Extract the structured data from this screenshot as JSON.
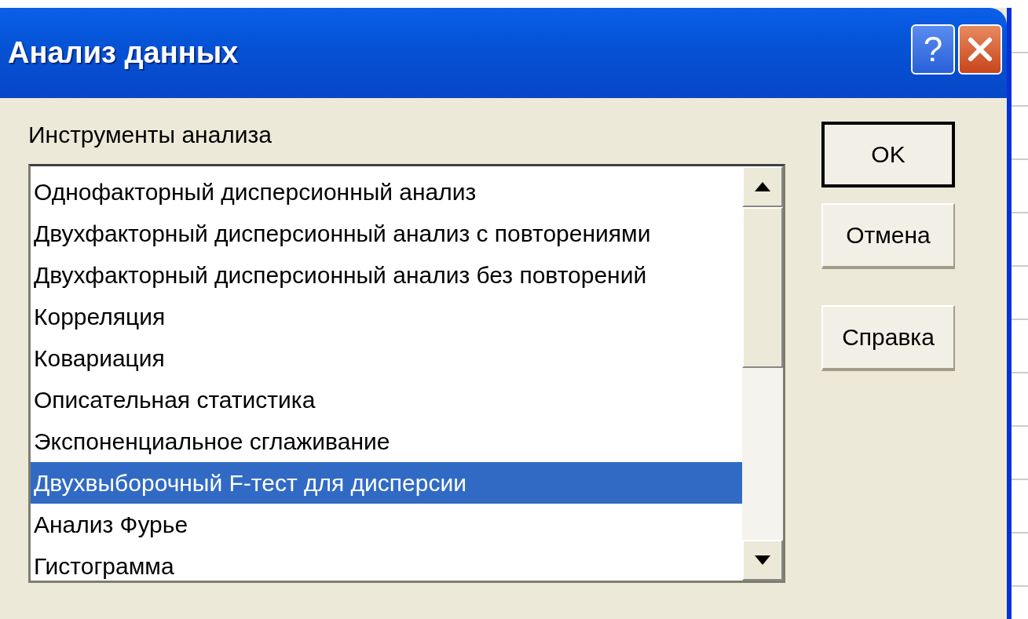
{
  "window": {
    "title": "Анализ данных",
    "help_button": "?"
  },
  "list": {
    "label": "Инструменты анализа",
    "items": [
      {
        "text": "Однофакторный дисперсионный анализ",
        "selected": false
      },
      {
        "text": "Двухфакторный дисперсионный анализ с повторениями",
        "selected": false
      },
      {
        "text": "Двухфакторный дисперсионный анализ без повторений",
        "selected": false
      },
      {
        "text": "Корреляция",
        "selected": false
      },
      {
        "text": "Ковариация",
        "selected": false
      },
      {
        "text": "Описательная статистика",
        "selected": false
      },
      {
        "text": "Экспоненциальное сглаживание",
        "selected": false
      },
      {
        "text": "Двухвыборочный F-тест для дисперсии",
        "selected": true
      },
      {
        "text": "Анализ Фурье",
        "selected": false
      },
      {
        "text": "Гистограмма",
        "selected": false
      }
    ]
  },
  "buttons": [
    {
      "label": "OK",
      "default": true
    },
    {
      "label": "Отмена",
      "default": false
    },
    {
      "label": "Справка",
      "default": false
    }
  ]
}
